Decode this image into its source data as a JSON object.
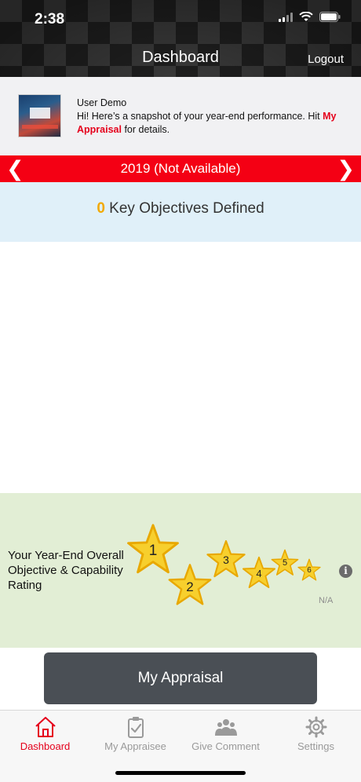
{
  "status_bar": {
    "time": "2:38"
  },
  "header": {
    "title": "Dashboard",
    "logout_label": "Logout"
  },
  "user_banner": {
    "name": "User Demo",
    "message_prefix": "Hi! Here’s a snapshot of your year-end performance. Hit ",
    "message_link": "My Appraisal",
    "message_suffix": " for details."
  },
  "year_bar": {
    "label": "2019 (Not Available)",
    "prev_glyph": "❮",
    "next_glyph": "❯"
  },
  "objectives": {
    "count": "0",
    "label": " Key Objectives Defined"
  },
  "rating": {
    "label": "Your Year-End Overall Objective & Capability Rating",
    "stars": [
      "1",
      "2",
      "3",
      "4",
      "5",
      "6"
    ],
    "value_text": "N/A",
    "info_glyph": "i"
  },
  "appraisal_button": {
    "label": "My Appraisal"
  },
  "tabs": [
    {
      "label": "Dashboard",
      "icon": "home-icon",
      "active": true
    },
    {
      "label": "My Appraisee",
      "icon": "clipboard-check-icon",
      "active": false
    },
    {
      "label": "Give Comment",
      "icon": "people-icon",
      "active": false
    },
    {
      "label": "Settings",
      "icon": "gear-icon",
      "active": false
    }
  ],
  "colors": {
    "accent_red": "#e5001b",
    "year_bar": "#f40014",
    "star_fill": "#f7cf2d",
    "objective_count": "#f2a900"
  }
}
